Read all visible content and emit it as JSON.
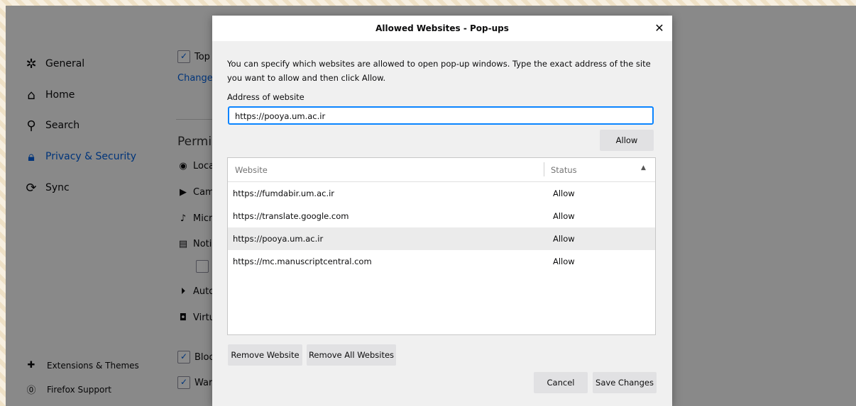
{
  "sidebar": {
    "items": [
      {
        "label": "General",
        "icon": "gear-icon"
      },
      {
        "label": "Home",
        "icon": "home-icon"
      },
      {
        "label": "Search",
        "icon": "search-icon"
      },
      {
        "label": "Privacy & Security",
        "icon": "lock-icon",
        "active": true
      },
      {
        "label": "Sync",
        "icon": "sync-icon"
      }
    ],
    "footer": [
      {
        "label": "Extensions & Themes",
        "icon": "puzzle-icon"
      },
      {
        "label": "Firefox Support",
        "icon": "help-icon"
      }
    ]
  },
  "background": {
    "top_option": "Top",
    "change_link": "Change",
    "permissions_heading": "Permis",
    "perms": [
      {
        "label": "Loca",
        "icon": "location-icon"
      },
      {
        "label": "Cam",
        "icon": "camera-icon"
      },
      {
        "label": "Micr",
        "icon": "microphone-icon"
      },
      {
        "label": "Noti",
        "icon": "notification-icon"
      },
      {
        "label": "Auto",
        "icon": "autoplay-icon"
      },
      {
        "label": "Virtu",
        "icon": "vr-icon"
      }
    ],
    "block_label": "Bloc",
    "warn_label": "War"
  },
  "dialog": {
    "title": "Allowed Websites - Pop-ups",
    "description": "You can specify which websites are allowed to open pop-up windows. Type the exact address of the site you want to allow and then click Allow.",
    "address_label": "Address of website",
    "address_value": "https://pooya.um.ac.ir",
    "allow_button": "Allow",
    "columns": {
      "website": "Website",
      "status": "Status"
    },
    "rows": [
      {
        "website": "https://fumdabir.um.ac.ir",
        "status": "Allow"
      },
      {
        "website": "https://translate.google.com",
        "status": "Allow"
      },
      {
        "website": "https://pooya.um.ac.ir",
        "status": "Allow",
        "selected": true
      },
      {
        "website": "https://mc.manuscriptcentral.com",
        "status": "Allow"
      }
    ],
    "remove_website": "Remove Website",
    "remove_all": "Remove All Websites",
    "cancel": "Cancel",
    "save": "Save Changes"
  }
}
